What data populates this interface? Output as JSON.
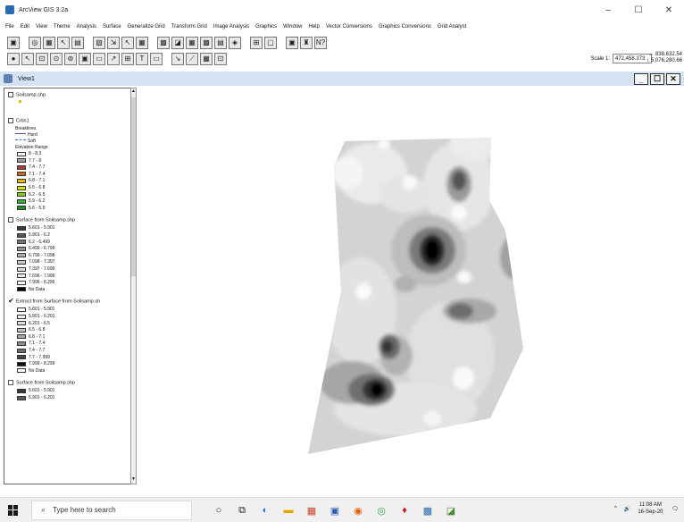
{
  "window": {
    "title": "ArcView GIS 3.2a",
    "min": "–",
    "max": "☐",
    "close": "✕"
  },
  "menu": [
    "File",
    "Edit",
    "View",
    "Theme",
    "Analysis",
    "Surface",
    "Generalize Grid",
    "Transform Grid",
    "Image Analysis",
    "Graphics",
    "Window",
    "Help",
    "Vector Conversions",
    "Graphics Conversions",
    "Grid Analyst"
  ],
  "toolbar": {
    "row1": [
      "▣",
      "◎",
      "▦",
      "↖",
      "▤",
      "▧",
      "⇲",
      "↖",
      "▦",
      "▩",
      "◪",
      "▦",
      "▩",
      "▤",
      "◈",
      "⊞",
      "▢",
      "▣",
      "♜",
      "N?"
    ],
    "row2": [
      "●",
      "↖",
      "⊡",
      "⊙",
      "⊚",
      "▣",
      "▭",
      "↗",
      "⊞",
      "T",
      "▭",
      "↘",
      "⟋",
      "▦",
      "⊡"
    ],
    "scale_label": "Scale 1:",
    "scale_value": "472,458.373",
    "coord_x": "↔ 838,632.54",
    "coord_y": "↕ 5,076,280.66"
  },
  "view": {
    "title": "View1",
    "min": "_",
    "max": "☐",
    "close": "✕"
  },
  "legend": {
    "themes": [
      {
        "name": "Soilsamp.shp",
        "checked": false,
        "entries": []
      },
      {
        "name": "Crtin1",
        "checked": false,
        "subheads": [
          "Breaklines",
          "Hard",
          "Soft",
          "Elevation Range"
        ],
        "entries": [
          {
            "label": "8 - 8.3",
            "color": "#ffffff"
          },
          {
            "label": "7.7 - 8",
            "color": "#a0a0a0"
          },
          {
            "label": "7.4 - 7.7",
            "color": "#b23a3a"
          },
          {
            "label": "7.1 - 7.4",
            "color": "#c86a1c"
          },
          {
            "label": "6.8 - 7.1",
            "color": "#e6b800"
          },
          {
            "label": "6.5 - 6.8",
            "color": "#d4e600"
          },
          {
            "label": "6.2 - 6.5",
            "color": "#7fd200"
          },
          {
            "label": "5.9 - 6.2",
            "color": "#33b233"
          },
          {
            "label": "5.6 - 5.9",
            "color": "#1f8f1f"
          }
        ]
      },
      {
        "name": "Surface from Soilsamp.shp",
        "checked": false,
        "entries": [
          {
            "label": "5.601 - 5.901",
            "color": "#3a3a3a"
          },
          {
            "label": "5.901 - 6.2",
            "color": "#5a5a5a"
          },
          {
            "label": "6.2 - 6.499",
            "color": "#777777"
          },
          {
            "label": "6.499 - 6.799",
            "color": "#939393"
          },
          {
            "label": "6.799 - 7.098",
            "color": "#adadad"
          },
          {
            "label": "7.098 - 7.397",
            "color": "#c6c6c6"
          },
          {
            "label": "7.397 - 7.696",
            "color": "#dcdcdc"
          },
          {
            "label": "7.696 - 7.996",
            "color": "#ececec"
          },
          {
            "label": "7.996 - 8.295",
            "color": "#f8f8f8"
          },
          {
            "label": "No Data",
            "color": "#000000"
          }
        ]
      },
      {
        "name": "Extract from Surface from Soilsamp.sh",
        "checked": true,
        "entries": [
          {
            "label": "5.601 - 5.901",
            "color": "#ffffff"
          },
          {
            "label": "5.901 - 6.201",
            "color": "#f2f2f2"
          },
          {
            "label": "6.201 - 6.5",
            "color": "#dedede"
          },
          {
            "label": "6.5 - 6.8",
            "color": "#c4c4c4"
          },
          {
            "label": "6.8 - 7.1",
            "color": "#a8a8a8"
          },
          {
            "label": "7.1 - 7.4",
            "color": "#8a8a8a"
          },
          {
            "label": "7.4 - 7.7",
            "color": "#6a6a6a"
          },
          {
            "label": "7.7 - 7.999",
            "color": "#444444"
          },
          {
            "label": "7.999 - 8.299",
            "color": "#111111"
          },
          {
            "label": "No Data",
            "color": "#ffffff"
          }
        ]
      },
      {
        "name": "Surface from Soilsamp.shp",
        "checked": false,
        "entries": [
          {
            "label": "5.601 - 5.901",
            "color": "#3a3a3a"
          },
          {
            "label": "5.901 - 6.201",
            "color": "#5a5a5a"
          }
        ]
      }
    ]
  },
  "taskbar": {
    "search_placeholder": "Type here to search",
    "icons": [
      "cortana-icon",
      "task-view-icon",
      "edge-icon",
      "file-explorer-icon",
      "powerpoint-icon",
      "media-icon",
      "firefox-icon",
      "chrome-icon",
      "app-red-icon",
      "app-blue-icon",
      "arcview-icon"
    ],
    "tray_chevron": "^",
    "volume": "🔊",
    "time": "11:08 AM",
    "date": "16-Sep-20",
    "notification": "🗨"
  }
}
